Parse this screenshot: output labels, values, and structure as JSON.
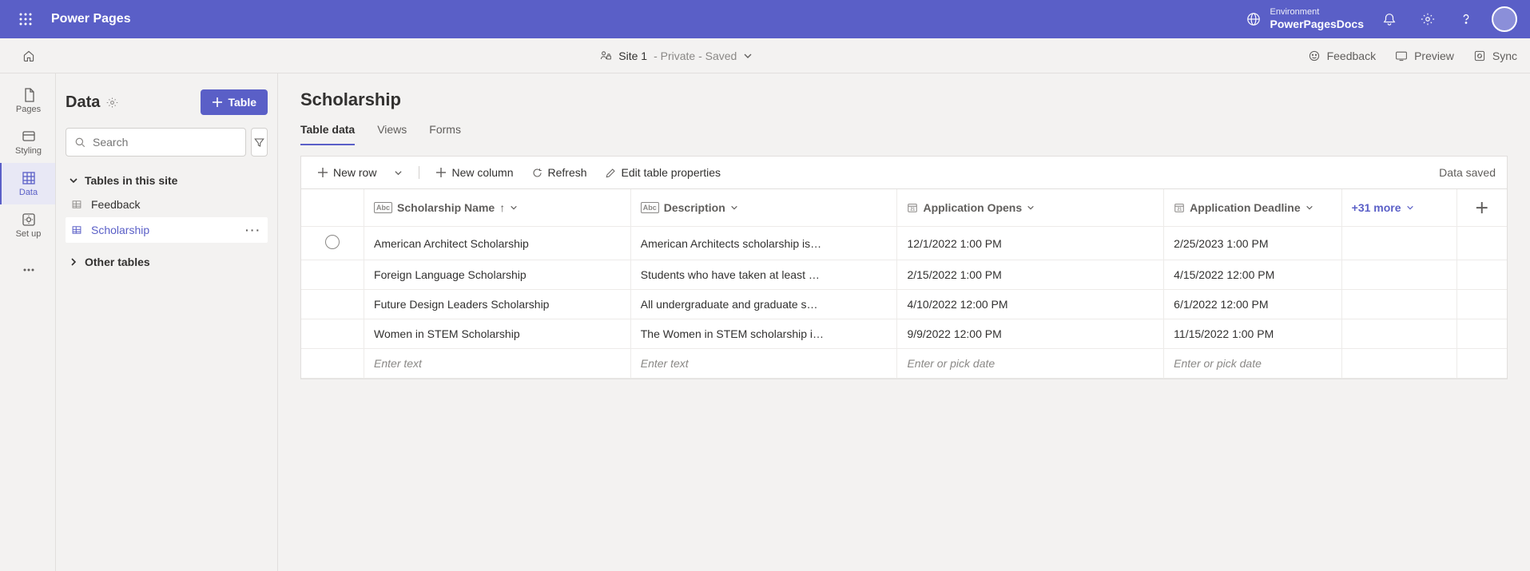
{
  "topbar": {
    "product": "Power Pages",
    "environment_label": "Environment",
    "environment_name": "PowerPagesDocs"
  },
  "subbar": {
    "site_name": "Site 1",
    "site_status": " - Private - Saved",
    "feedback": "Feedback",
    "preview": "Preview",
    "sync": "Sync"
  },
  "rail": {
    "pages": "Pages",
    "styling": "Styling",
    "data": "Data",
    "setup": "Set up"
  },
  "panel": {
    "title": "Data",
    "table_button": "Table",
    "search_placeholder": "Search",
    "section1": "Tables in this site",
    "items": [
      "Feedback",
      "Scholarship"
    ],
    "section2": "Other tables"
  },
  "main": {
    "title": "Scholarship",
    "tabs": [
      "Table data",
      "Views",
      "Forms"
    ],
    "toolbar": {
      "new_row": "New row",
      "new_column": "New column",
      "refresh": "Refresh",
      "edit_props": "Edit table properties",
      "saved": "Data saved"
    },
    "columns": {
      "name": "Scholarship Name",
      "desc": "Description",
      "opens": "Application Opens",
      "deadline": "Application Deadline",
      "more": "+31 more"
    },
    "rows": [
      {
        "name": "American Architect Scholarship",
        "desc": "American Architects scholarship is…",
        "opens": "12/1/2022 1:00 PM",
        "deadline": "2/25/2023 1:00 PM"
      },
      {
        "name": "Foreign Language Scholarship",
        "desc": "Students who have taken at least …",
        "opens": "2/15/2022 1:00 PM",
        "deadline": "4/15/2022 12:00 PM"
      },
      {
        "name": "Future Design Leaders Scholarship",
        "desc": "All undergraduate and graduate s…",
        "opens": "4/10/2022 12:00 PM",
        "deadline": "6/1/2022 12:00 PM"
      },
      {
        "name": "Women in STEM Scholarship",
        "desc": "The Women in STEM scholarship i…",
        "opens": "9/9/2022 12:00 PM",
        "deadline": "11/15/2022 1:00 PM"
      }
    ],
    "placeholders": {
      "text": "Enter text",
      "date": "Enter or pick date"
    }
  }
}
